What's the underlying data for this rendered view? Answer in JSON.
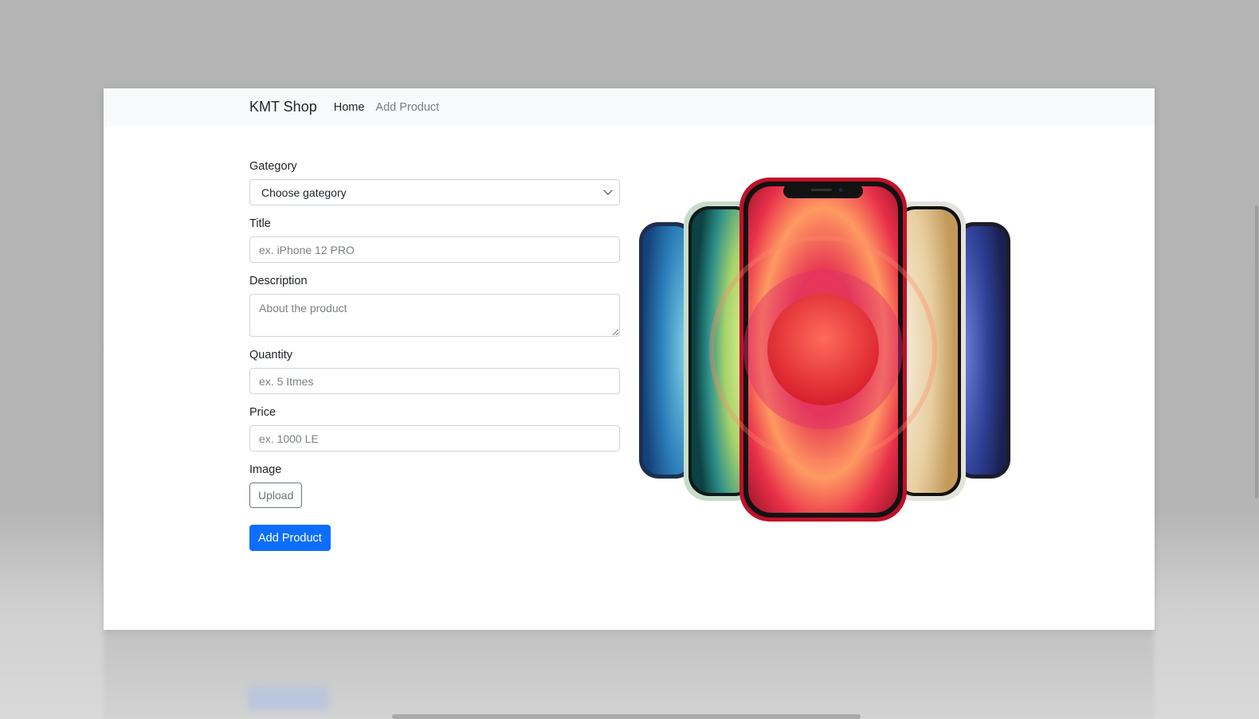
{
  "navbar": {
    "brand": "KMT Shop",
    "links": [
      {
        "label": "Home"
      },
      {
        "label": "Add Product"
      }
    ]
  },
  "form": {
    "category": {
      "label": "Gategory",
      "selected": "Choose gategory"
    },
    "title": {
      "label": "Title",
      "placeholder": "ex. iPhone 12 PRO"
    },
    "description": {
      "label": "Description",
      "placeholder": "About the product"
    },
    "quantity": {
      "label": "Quantity",
      "placeholder": "ex. 5 Itmes"
    },
    "price": {
      "label": "Price",
      "placeholder": "ex. 1000 LE"
    },
    "image": {
      "label": "Image",
      "upload_label": "Upload"
    },
    "submit_label": "Add Product"
  },
  "colors": {
    "primary": "#0d6efd",
    "navbar_bg": "#f8f9fa",
    "secondary": "#6c757d"
  },
  "icons": {
    "select": "chevron-down-icon"
  }
}
